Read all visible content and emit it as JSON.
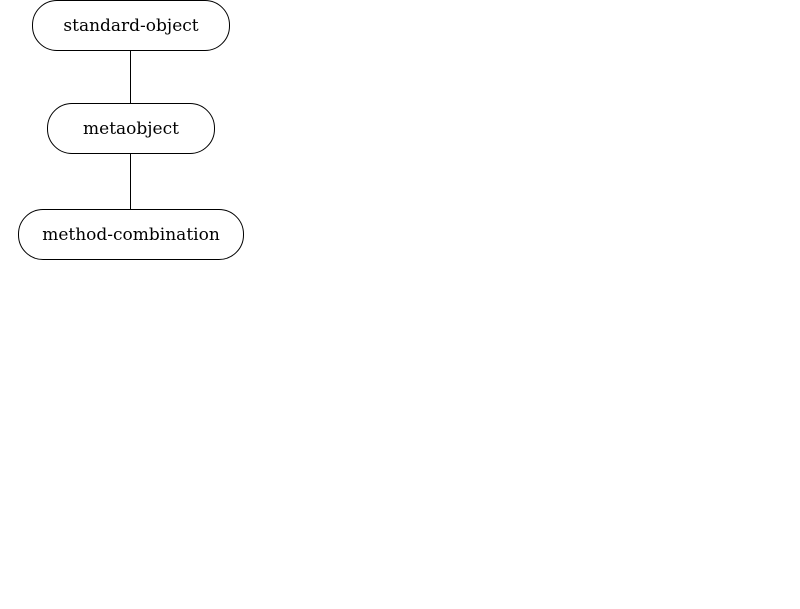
{
  "diagram": {
    "nodes": [
      {
        "id": "standard-object",
        "label": "standard-object"
      },
      {
        "id": "metaobject",
        "label": "metaobject"
      },
      {
        "id": "method-combination",
        "label": "method-combination"
      }
    ],
    "edges": [
      {
        "from": "standard-object",
        "to": "metaobject"
      },
      {
        "from": "metaobject",
        "to": "method-combination"
      }
    ]
  }
}
